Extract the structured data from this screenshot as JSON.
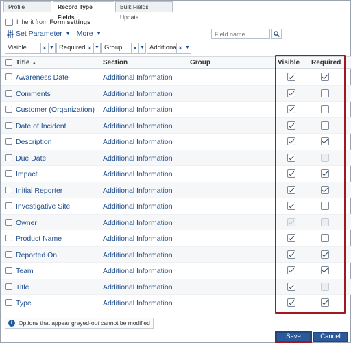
{
  "tabs": [
    {
      "label": "Profile",
      "active": false
    },
    {
      "label": "Record Type Fields",
      "active": true
    },
    {
      "label": "Bulk Fields Update",
      "active": false
    }
  ],
  "inherit": {
    "label": "Inherit from",
    "bold": "Form settings",
    "checked": false
  },
  "toolbar": {
    "set_parameter": "Set Parameter",
    "more": "More"
  },
  "search": {
    "placeholder": "Field name..."
  },
  "filters": [
    "Visible",
    "Required",
    "Group",
    "Additional"
  ],
  "columns": {
    "title": "Title",
    "section": "Section",
    "group": "Group",
    "visible": "Visible",
    "required": "Required"
  },
  "rows": [
    {
      "title": "Awareness Date",
      "section": "Additional Information",
      "visible": true,
      "visible_disabled": false,
      "required": true,
      "required_disabled": false
    },
    {
      "title": "Comments",
      "section": "Additional Information",
      "visible": true,
      "visible_disabled": false,
      "required": false,
      "required_disabled": false
    },
    {
      "title": "Customer (Organization)",
      "section": "Additional Information",
      "visible": true,
      "visible_disabled": false,
      "required": false,
      "required_disabled": false
    },
    {
      "title": "Date of Incident",
      "section": "Additional Information",
      "visible": true,
      "visible_disabled": false,
      "required": false,
      "required_disabled": false
    },
    {
      "title": "Description",
      "section": "Additional Information",
      "visible": true,
      "visible_disabled": false,
      "required": true,
      "required_disabled": false
    },
    {
      "title": "Due Date",
      "section": "Additional Information",
      "visible": true,
      "visible_disabled": false,
      "required": false,
      "required_disabled": true
    },
    {
      "title": "Impact",
      "section": "Additional Information",
      "visible": true,
      "visible_disabled": false,
      "required": true,
      "required_disabled": false
    },
    {
      "title": "Initial Reporter",
      "section": "Additional Information",
      "visible": true,
      "visible_disabled": false,
      "required": true,
      "required_disabled": false
    },
    {
      "title": "Investigative Site",
      "section": "Additional Information",
      "visible": true,
      "visible_disabled": false,
      "required": false,
      "required_disabled": false
    },
    {
      "title": "Owner",
      "section": "Additional Information",
      "visible": true,
      "visible_disabled": true,
      "required": false,
      "required_disabled": true
    },
    {
      "title": "Product Name",
      "section": "Additional Information",
      "visible": true,
      "visible_disabled": false,
      "required": false,
      "required_disabled": false
    },
    {
      "title": "Reported On",
      "section": "Additional Information",
      "visible": true,
      "visible_disabled": false,
      "required": true,
      "required_disabled": false
    },
    {
      "title": "Team",
      "section": "Additional Information",
      "visible": true,
      "visible_disabled": false,
      "required": true,
      "required_disabled": false
    },
    {
      "title": "Title",
      "section": "Additional Information",
      "visible": true,
      "visible_disabled": false,
      "required": false,
      "required_disabled": true
    },
    {
      "title": "Type",
      "section": "Additional Information",
      "visible": true,
      "visible_disabled": false,
      "required": true,
      "required_disabled": false
    }
  ],
  "note": "Options that appear greyed-out cannot be modified",
  "buttons": {
    "save": "Save",
    "cancel": "Cancel"
  },
  "colors": {
    "link": "#1f4e8c",
    "highlight": "#a01820",
    "button": "#2a5a9a"
  },
  "icons": {
    "set_parameter": "sliders-icon",
    "search": "magnifier-icon",
    "sort": "sort-ascending-icon",
    "info": "info-icon"
  }
}
